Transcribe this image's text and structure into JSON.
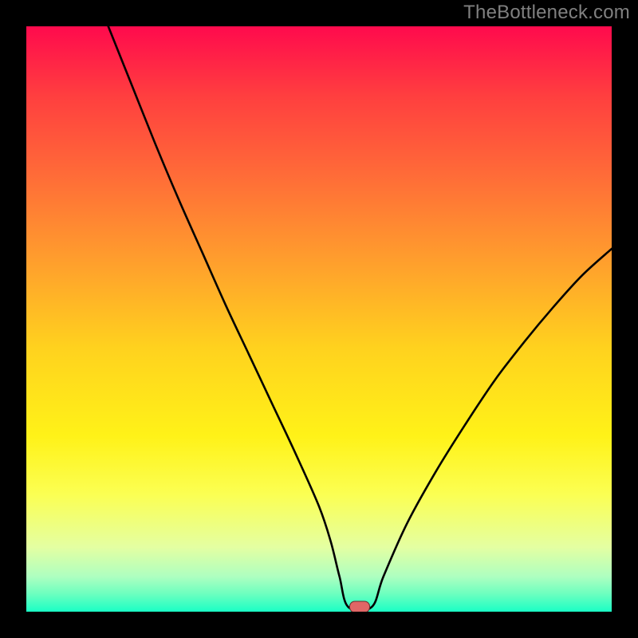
{
  "watermark": "TheBottleneck.com",
  "chart_data": {
    "type": "line",
    "title": "",
    "xlabel": "",
    "ylabel": "",
    "xlim": [
      0,
      100
    ],
    "ylim": [
      0,
      100
    ],
    "grid": false,
    "background": "rainbow-vertical-gradient",
    "gradient_stops": [
      {
        "pos": 0,
        "color": "#ff0a4d"
      },
      {
        "pos": 12,
        "color": "#ff3f3f"
      },
      {
        "pos": 25,
        "color": "#ff6a38"
      },
      {
        "pos": 40,
        "color": "#ff9e2d"
      },
      {
        "pos": 55,
        "color": "#ffd21e"
      },
      {
        "pos": 70,
        "color": "#fff218"
      },
      {
        "pos": 80,
        "color": "#fbff53"
      },
      {
        "pos": 89,
        "color": "#e4ffa2"
      },
      {
        "pos": 94,
        "color": "#aeffc0"
      },
      {
        "pos": 97,
        "color": "#6bffbf"
      },
      {
        "pos": 100,
        "color": "#1affc5"
      }
    ],
    "series": [
      {
        "name": "left-branch",
        "x": [
          14,
          18,
          22,
          26,
          30,
          34,
          38,
          42,
          46,
          50,
          52,
          53.5,
          55
        ],
        "y": [
          100,
          90,
          80,
          70.5,
          61.5,
          52.5,
          44,
          35.5,
          27,
          18,
          12,
          6,
          0.8
        ]
      },
      {
        "name": "right-branch",
        "x": [
          59,
          61,
          65,
          70,
          75,
          80,
          85,
          90,
          95,
          100
        ],
        "y": [
          0.8,
          6,
          15,
          24,
          32,
          39.5,
          46,
          52,
          57.5,
          62
        ]
      },
      {
        "name": "valley-floor",
        "x": [
          55,
          59
        ],
        "y": [
          0.8,
          0.8
        ]
      }
    ],
    "marker": {
      "x": 57,
      "y": 0.8,
      "color": "#e06666",
      "shape": "pill"
    }
  }
}
